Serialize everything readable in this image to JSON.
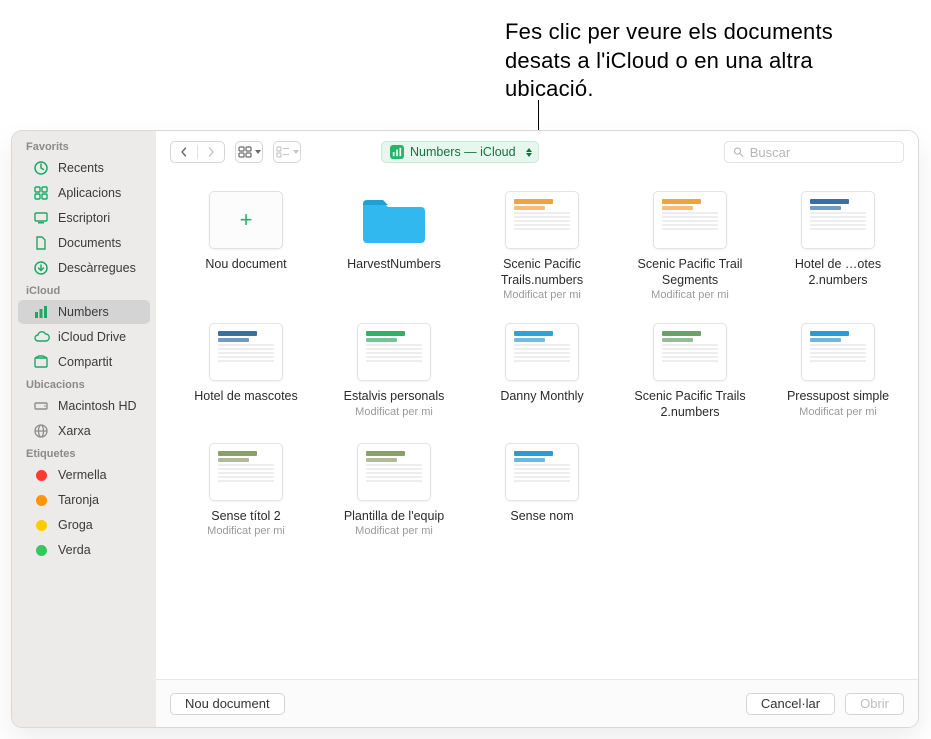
{
  "callout": "Fes clic per veure els documents desats a l'iCloud o en una altra ubicació.",
  "location_pill": "Numbers — iCloud",
  "search_placeholder": "Buscar",
  "sidebar": {
    "sections": [
      {
        "title": "Favorits",
        "items": [
          {
            "icon": "clock",
            "label": "Recents"
          },
          {
            "icon": "apps",
            "label": "Aplicacions"
          },
          {
            "icon": "desktop",
            "label": "Escriptori"
          },
          {
            "icon": "doc",
            "label": "Documents"
          },
          {
            "icon": "download",
            "label": "Descàrregues"
          }
        ]
      },
      {
        "title": "iCloud",
        "items": [
          {
            "icon": "numbers",
            "label": "Numbers",
            "selected": true
          },
          {
            "icon": "cloud",
            "label": "iCloud Drive"
          },
          {
            "icon": "shared",
            "label": "Compartit"
          }
        ]
      },
      {
        "title": "Ubicacions",
        "items": [
          {
            "icon": "hd",
            "label": "Macintosh HD"
          },
          {
            "icon": "network",
            "label": "Xarxa"
          }
        ]
      },
      {
        "title": "Etiquetes",
        "items": [
          {
            "icon": "tag",
            "color": "#ff3b30",
            "label": "Vermella"
          },
          {
            "icon": "tag",
            "color": "#ff9500",
            "label": "Taronja"
          },
          {
            "icon": "tag",
            "color": "#ffcc00",
            "label": "Groga"
          },
          {
            "icon": "tag",
            "color": "#34c759",
            "label": "Verda"
          }
        ]
      }
    ]
  },
  "grid": [
    {
      "kind": "new",
      "title": "Nou document"
    },
    {
      "kind": "folder",
      "title": "HarvestNumbers"
    },
    {
      "kind": "doc",
      "title": "Scenic Pacific Trails.numbers",
      "sub": "Modificat per mi",
      "accent": "#f2a23a"
    },
    {
      "kind": "doc",
      "title": "Scenic Pacific Trail Segments",
      "sub": "Modificat per mi",
      "accent": "#f2a23a"
    },
    {
      "kind": "doc",
      "title": "Hotel de …otes 2.numbers",
      "accent": "#3b6ea5"
    },
    {
      "kind": "doc",
      "title": "Hotel de mascotes",
      "accent": "#3b6ea5"
    },
    {
      "kind": "doc",
      "title": "Estalvis personals",
      "sub": "Modificat per mi",
      "accent": "#32b06a"
    },
    {
      "kind": "doc",
      "title": "Danny Monthly",
      "accent": "#2fa2d9"
    },
    {
      "kind": "doc",
      "title": "Scenic Pacific Trails 2.numbers",
      "accent": "#6aa06a"
    },
    {
      "kind": "doc",
      "title": "Pressupost simple",
      "sub": "Modificat per mi",
      "accent": "#2b9bd8"
    },
    {
      "kind": "doc",
      "title": "Sense títol 2",
      "sub": "Modificat per mi",
      "accent": "#8aa06a"
    },
    {
      "kind": "doc",
      "title": "Plantilla de l'equip",
      "sub": "Modificat per mi",
      "accent": "#8aa06a"
    },
    {
      "kind": "doc",
      "title": "Sense nom",
      "accent": "#2b9bd8"
    }
  ],
  "footer": {
    "new_document": "Nou document",
    "cancel": "Cancel·lar",
    "open": "Obrir"
  }
}
